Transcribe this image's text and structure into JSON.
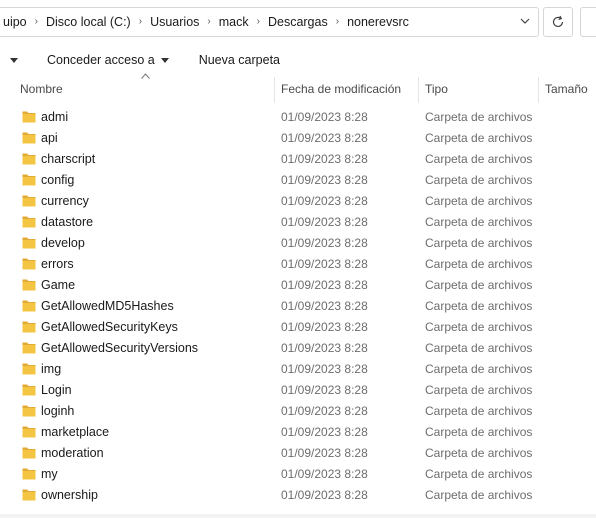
{
  "address": {
    "crumbs": [
      "uipo",
      "Disco local (C:)",
      "Usuarios",
      "mack",
      "Descargas",
      "nonerevsrc"
    ]
  },
  "toolbar": {
    "concede_label": "Conceder acceso a",
    "new_folder_label": "Nueva carpeta"
  },
  "columns": {
    "name": "Nombre",
    "date": "Fecha de modificación",
    "type": "Tipo",
    "size": "Tamaño"
  },
  "files": [
    {
      "name": "admi",
      "date": "01/09/2023 8:28",
      "type": "Carpeta de archivos"
    },
    {
      "name": "api",
      "date": "01/09/2023 8:28",
      "type": "Carpeta de archivos"
    },
    {
      "name": "charscript",
      "date": "01/09/2023 8:28",
      "type": "Carpeta de archivos"
    },
    {
      "name": "config",
      "date": "01/09/2023 8:28",
      "type": "Carpeta de archivos"
    },
    {
      "name": "currency",
      "date": "01/09/2023 8:28",
      "type": "Carpeta de archivos"
    },
    {
      "name": "datastore",
      "date": "01/09/2023 8:28",
      "type": "Carpeta de archivos"
    },
    {
      "name": "develop",
      "date": "01/09/2023 8:28",
      "type": "Carpeta de archivos"
    },
    {
      "name": "errors",
      "date": "01/09/2023 8:28",
      "type": "Carpeta de archivos"
    },
    {
      "name": "Game",
      "date": "01/09/2023 8:28",
      "type": "Carpeta de archivos"
    },
    {
      "name": "GetAllowedMD5Hashes",
      "date": "01/09/2023 8:28",
      "type": "Carpeta de archivos"
    },
    {
      "name": "GetAllowedSecurityKeys",
      "date": "01/09/2023 8:28",
      "type": "Carpeta de archivos"
    },
    {
      "name": "GetAllowedSecurityVersions",
      "date": "01/09/2023 8:28",
      "type": "Carpeta de archivos"
    },
    {
      "name": "img",
      "date": "01/09/2023 8:28",
      "type": "Carpeta de archivos"
    },
    {
      "name": "Login",
      "date": "01/09/2023 8:28",
      "type": "Carpeta de archivos"
    },
    {
      "name": "loginh",
      "date": "01/09/2023 8:28",
      "type": "Carpeta de archivos"
    },
    {
      "name": "marketplace",
      "date": "01/09/2023 8:28",
      "type": "Carpeta de archivos"
    },
    {
      "name": "moderation",
      "date": "01/09/2023 8:28",
      "type": "Carpeta de archivos"
    },
    {
      "name": "my",
      "date": "01/09/2023 8:28",
      "type": "Carpeta de archivos"
    },
    {
      "name": "ownership",
      "date": "01/09/2023 8:28",
      "type": "Carpeta de archivos"
    }
  ],
  "colors": {
    "folder_body": "#f4c542",
    "folder_tab": "#e2a934",
    "secondary_text": "#6d6d6d"
  }
}
